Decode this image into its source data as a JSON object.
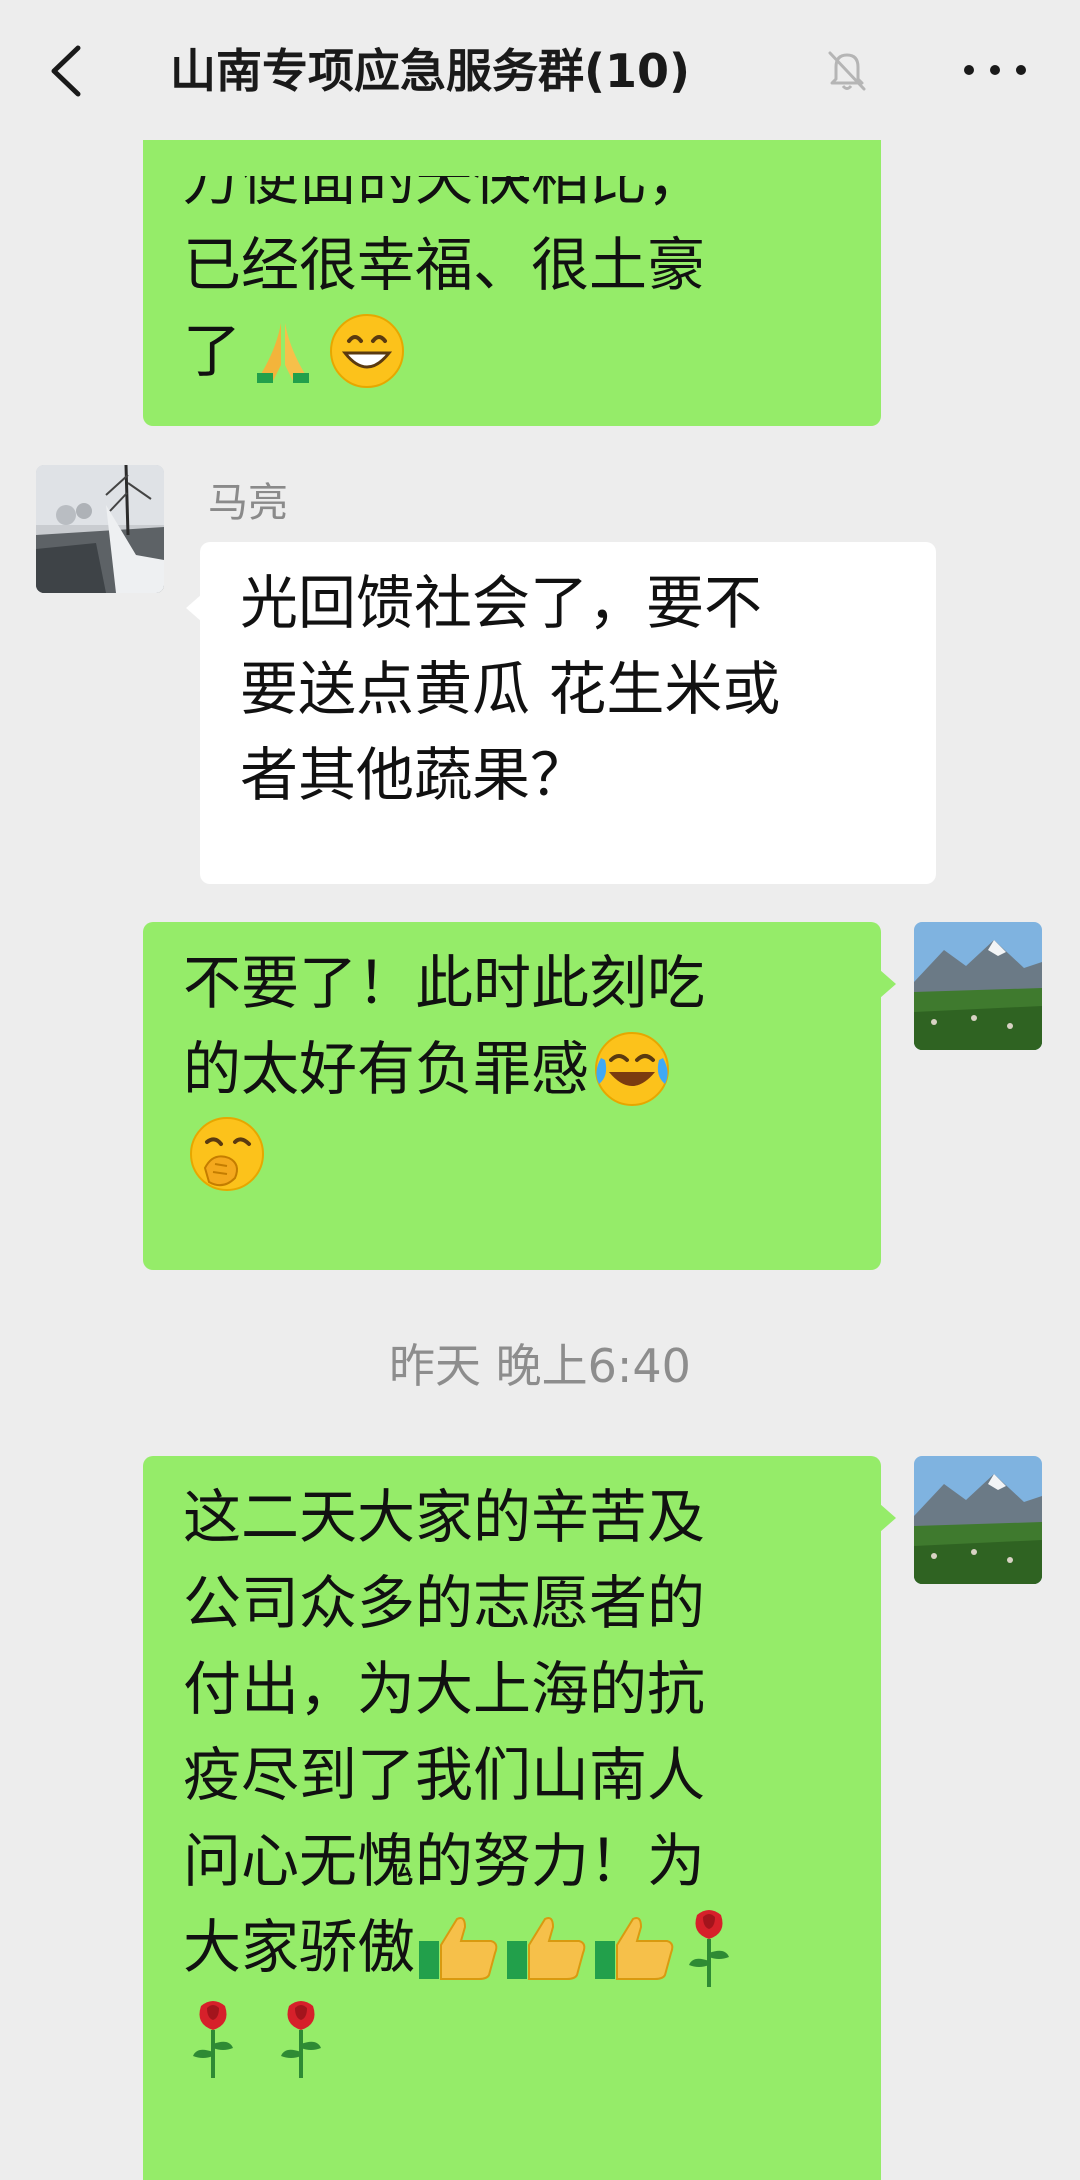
{
  "header": {
    "title": "山南专项应急服务群(10)",
    "back_icon": "chevron-left-icon",
    "mute_icon": "bell-off-icon",
    "more_icon": "more-icon"
  },
  "messages": [
    {
      "side": "right",
      "lines": [
        "万便面的天快相比，",
        "已经很幸福、很土豪",
        "了"
      ],
      "emojis": [
        "folded-hands",
        "grinning-face"
      ]
    },
    {
      "side": "left",
      "sender": "马亮",
      "lines": [
        "光回馈社会了，要不",
        "要送点黄瓜 花生米或",
        "者其他蔬果？"
      ]
    },
    {
      "side": "right",
      "lines": [
        "不要了！此时此刻吃",
        "的太好有负罪感"
      ],
      "emojis": [
        "crying-laughing",
        "face-hand-over-mouth"
      ]
    },
    {
      "timestamp": "昨天 晚上6:40"
    },
    {
      "side": "right",
      "lines": [
        "这二天大家的辛苦及",
        "公司众多的志愿者的",
        "付出，为大上海的抗",
        "疫尽到了我们山南人",
        "问心无愧的努力！为",
        "大家骄傲"
      ],
      "emojis": [
        "thumbs-up",
        "thumbs-up",
        "thumbs-up",
        "rose",
        "rose",
        "rose"
      ]
    }
  ],
  "colors": {
    "background": "#ededed",
    "outgoing_bubble": "#95ec69",
    "incoming_bubble": "#ffffff",
    "secondary_text": "#8a8a8a"
  }
}
